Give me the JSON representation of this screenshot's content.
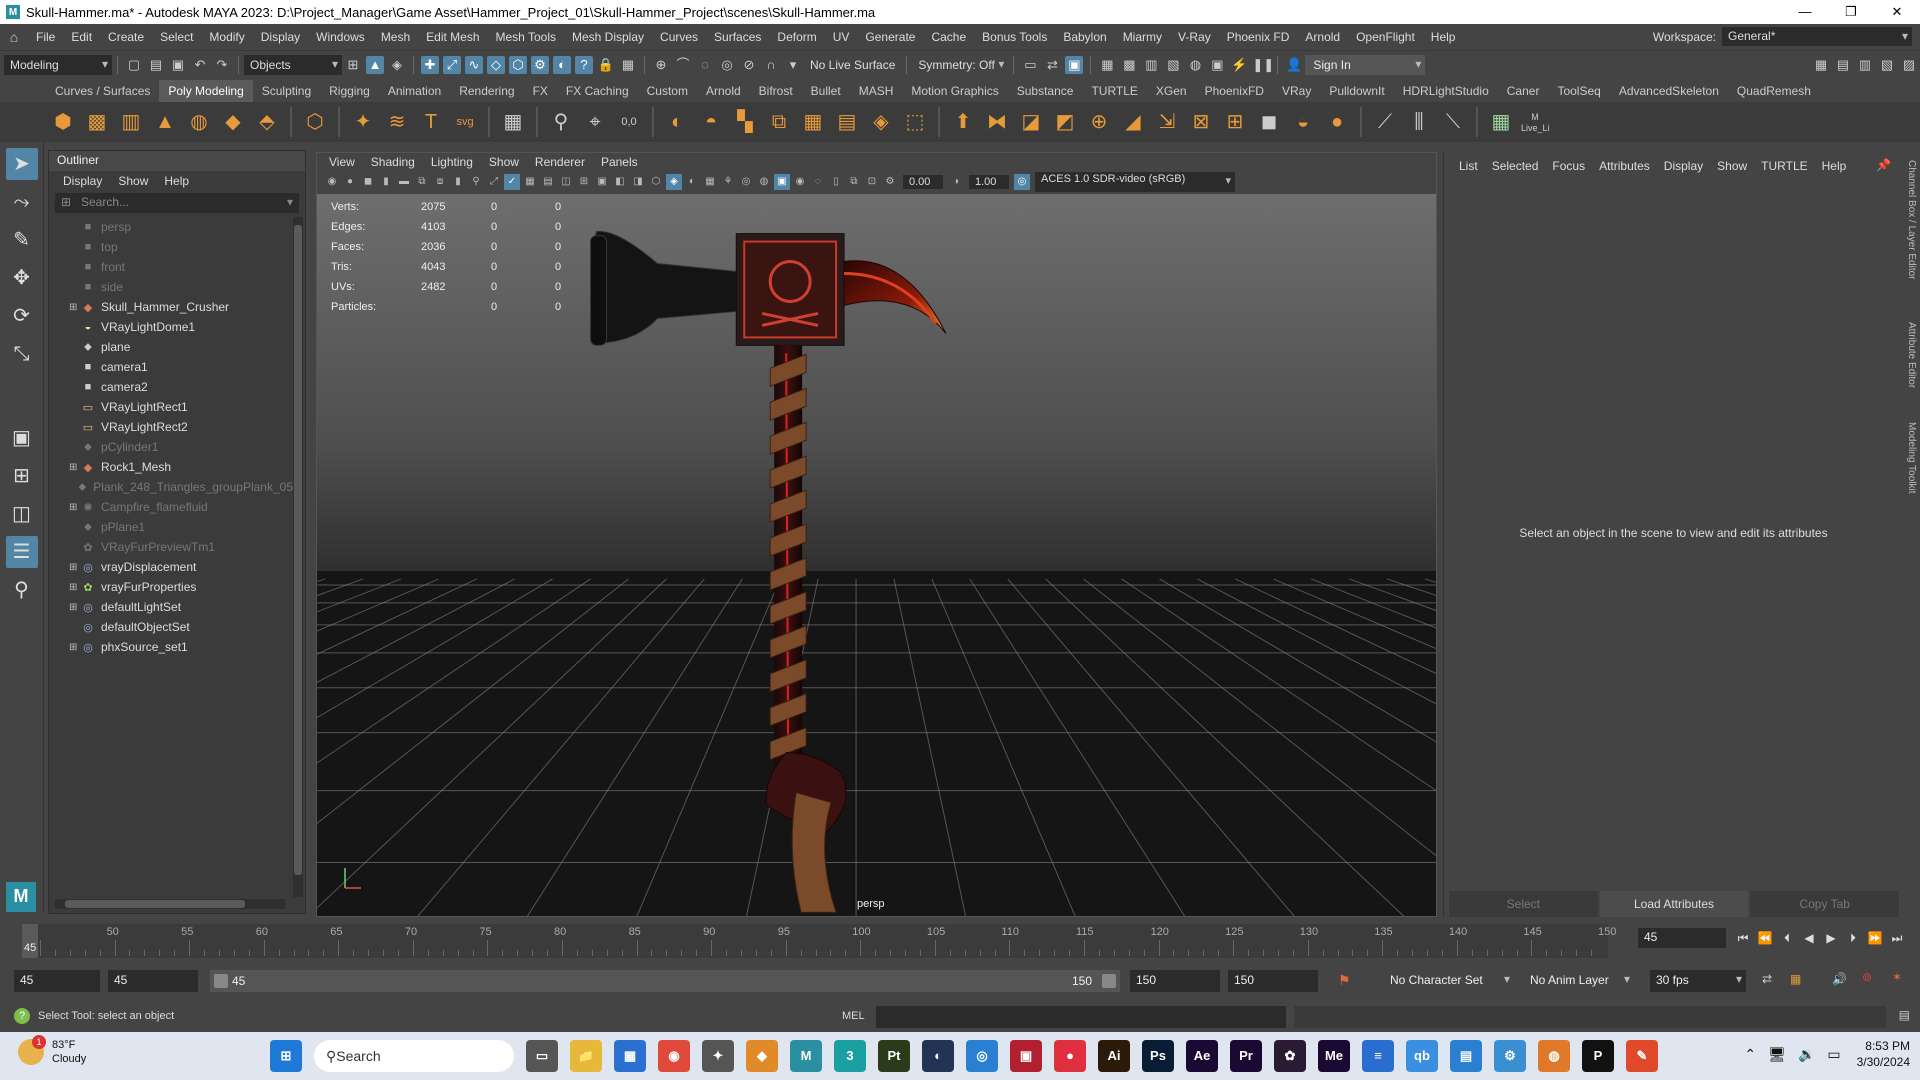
{
  "window": {
    "title": "Skull-Hammer.ma* - Autodesk MAYA 2023: D:\\Project_Manager\\Game Asset\\Hammer_Project_01\\Skull-Hammer_Project\\scenes\\Skull-Hammer.ma",
    "min": "—",
    "max": "❐",
    "close": "✕"
  },
  "menu": {
    "items": [
      "File",
      "Edit",
      "Create",
      "Select",
      "Modify",
      "Display",
      "Windows",
      "Mesh",
      "Edit Mesh",
      "Mesh Tools",
      "Mesh Display",
      "Curves",
      "Surfaces",
      "Deform",
      "UV",
      "Generate",
      "Cache",
      "Bonus Tools",
      "Babylon",
      "Miarmy",
      "V-Ray",
      "Phoenix FD",
      "Arnold",
      "OpenFlight",
      "Help"
    ],
    "workspace_label": "Workspace:",
    "workspace_value": "General*"
  },
  "status": {
    "mode": "Modeling",
    "objects": "Objects",
    "live_surface": "No Live Surface",
    "symmetry": "Symmetry: Off",
    "sign_in": "Sign In"
  },
  "shelf": {
    "tabs": [
      "Curves / Surfaces",
      "Poly Modeling",
      "Sculpting",
      "Rigging",
      "Animation",
      "Rendering",
      "FX",
      "FX Caching",
      "Custom",
      "Arnold",
      "Bifrost",
      "Bullet",
      "MASH",
      "Motion Graphics",
      "Substance",
      "TURTLE",
      "XGen",
      "PhoenixFD",
      "VRay",
      "PulldownIt",
      "HDRLightStudio",
      "Caner",
      "ToolSeq",
      "AdvancedSkeleton",
      "QuadRemesh"
    ],
    "active": "Poly Modeling",
    "live_label": "Live_Li"
  },
  "outliner": {
    "title": "Outliner",
    "menu": [
      "Display",
      "Show",
      "Help"
    ],
    "search_placeholder": "Search...",
    "items": [
      {
        "label": "persp",
        "dim": true,
        "expand": false,
        "icon": "camera-icon"
      },
      {
        "label": "top",
        "dim": true,
        "expand": false,
        "icon": "camera-icon"
      },
      {
        "label": "front",
        "dim": true,
        "expand": false,
        "icon": "camera-icon"
      },
      {
        "label": "side",
        "dim": true,
        "expand": false,
        "icon": "camera-icon"
      },
      {
        "label": "Skull_Hammer_Crusher",
        "dim": false,
        "expand": true,
        "icon": "mesh-icon"
      },
      {
        "label": "VRayLightDome1",
        "dim": false,
        "expand": false,
        "icon": "dome-light-icon"
      },
      {
        "label": "plane",
        "dim": false,
        "expand": false,
        "icon": "transform-icon"
      },
      {
        "label": "camera1",
        "dim": false,
        "expand": false,
        "icon": "camera-icon"
      },
      {
        "label": "camera2",
        "dim": false,
        "expand": false,
        "icon": "camera-icon"
      },
      {
        "label": "VRayLightRect1",
        "dim": false,
        "expand": false,
        "icon": "rect-light-icon"
      },
      {
        "label": "VRayLightRect2",
        "dim": false,
        "expand": false,
        "icon": "rect-light-icon"
      },
      {
        "label": "pCylinder1",
        "dim": true,
        "expand": false,
        "icon": "transform-icon"
      },
      {
        "label": "Rock1_Mesh",
        "dim": false,
        "expand": true,
        "icon": "mesh-icon"
      },
      {
        "label": "Plank_248_Triangles_groupPlank_05",
        "dim": true,
        "expand": false,
        "icon": "transform-icon"
      },
      {
        "label": "Campfire_flamefluid",
        "dim": true,
        "expand": true,
        "icon": "fluid-icon"
      },
      {
        "label": "pPlane1",
        "dim": true,
        "expand": false,
        "icon": "transform-icon"
      },
      {
        "label": "VRayFurPreviewTm1",
        "dim": true,
        "expand": false,
        "icon": "fur-icon"
      },
      {
        "label": "vrayDisplacement",
        "dim": false,
        "expand": true,
        "icon": "set-icon"
      },
      {
        "label": "vrayFurProperties",
        "dim": false,
        "expand": true,
        "icon": "fur-icon"
      },
      {
        "label": "defaultLightSet",
        "dim": false,
        "expand": true,
        "icon": "set-icon"
      },
      {
        "label": "defaultObjectSet",
        "dim": false,
        "expand": false,
        "icon": "set-icon"
      },
      {
        "label": "phxSource_set1",
        "dim": false,
        "expand": true,
        "icon": "set-icon"
      }
    ]
  },
  "viewport": {
    "menu": [
      "View",
      "Shading",
      "Lighting",
      "Show",
      "Renderer",
      "Panels"
    ],
    "exposure": "0.00",
    "gamma": "1.00",
    "color_space": "ACES 1.0 SDR-video (sRGB)",
    "camera": "persp",
    "hud": [
      {
        "label": "Verts:",
        "v": "2075",
        "a": "0",
        "b": "0"
      },
      {
        "label": "Edges:",
        "v": "4103",
        "a": "0",
        "b": "0"
      },
      {
        "label": "Faces:",
        "v": "2036",
        "a": "0",
        "b": "0"
      },
      {
        "label": "Tris:",
        "v": "4043",
        "a": "0",
        "b": "0"
      },
      {
        "label": "UVs:",
        "v": "2482",
        "a": "0",
        "b": "0"
      },
      {
        "label": "Particles:",
        "v": "",
        "a": "0",
        "b": "0"
      }
    ]
  },
  "attribute_editor": {
    "menu": [
      "List",
      "Selected",
      "Focus",
      "Attributes",
      "Display",
      "Show",
      "TURTLE",
      "Help"
    ],
    "message": "Select an object in the scene to view and edit its attributes",
    "buttons": [
      "Select",
      "Load Attributes",
      "Copy Tab"
    ],
    "side_tabs": [
      "Channel Box / Layer Editor",
      "Attribute Editor",
      "Modeling Toolkit"
    ]
  },
  "timeline": {
    "current": "45",
    "ticks": [
      "50",
      "55",
      "60",
      "65",
      "70",
      "75",
      "80",
      "85",
      "90",
      "95",
      "100",
      "105",
      "110",
      "115",
      "120",
      "125",
      "130",
      "135",
      "140",
      "145",
      "150"
    ],
    "frame_field": "45",
    "start": "45",
    "range_start": "45",
    "range_bar_start": "45",
    "range_bar_end": "150",
    "range_end": "150",
    "end": "150",
    "character_set": "No Character Set",
    "anim_layer": "No Anim Layer",
    "fps": "30 fps"
  },
  "command": {
    "hint": "Select Tool: select an object",
    "mel": "MEL"
  },
  "taskbar": {
    "temp": "83°F",
    "condition": "Cloudy",
    "badge": "1",
    "search": "Search",
    "apps": [
      {
        "name": "start-icon",
        "label": "⊞",
        "color": "#1e7ad6"
      },
      {
        "name": "task-view-icon",
        "label": "▭",
        "color": "#555"
      },
      {
        "name": "file-explorer-icon",
        "label": "📁",
        "color": "#e6b93a"
      },
      {
        "name": "store-icon",
        "label": "▦",
        "color": "#2b6fd0"
      },
      {
        "name": "chrome-icon",
        "label": "◉",
        "color": "#e04a3a"
      },
      {
        "name": "app-icon",
        "label": "✦",
        "color": "#555"
      },
      {
        "name": "app2-icon",
        "label": "◆",
        "color": "#e08a2a"
      },
      {
        "name": "maya-icon",
        "label": "M",
        "color": "#2a8fa0"
      },
      {
        "name": "3dsmax-icon",
        "label": "3",
        "color": "#1aa0a0"
      },
      {
        "name": "painter-icon",
        "label": "Pt",
        "color": "#2a3a1a"
      },
      {
        "name": "app3-icon",
        "label": "◐",
        "color": "#223355"
      },
      {
        "name": "app4-icon",
        "label": "◎",
        "color": "#2a7fd0"
      },
      {
        "name": "app5-icon",
        "label": "▣",
        "color": "#b02030"
      },
      {
        "name": "app6-icon",
        "label": "●",
        "color": "#e03040"
      },
      {
        "name": "illustrator-icon",
        "label": "Ai",
        "color": "#2b1a07"
      },
      {
        "name": "photoshop-icon",
        "label": "Ps",
        "color": "#0a1c33"
      },
      {
        "name": "aftereffects-icon",
        "label": "Ae",
        "color": "#1a0a33"
      },
      {
        "name": "premiere-icon",
        "label": "Pr",
        "color": "#1a0a33"
      },
      {
        "name": "app7-icon",
        "label": "✿",
        "color": "#2a1a33"
      },
      {
        "name": "media-encoder-icon",
        "label": "Me",
        "color": "#1a0a33"
      },
      {
        "name": "app8-icon",
        "label": "≡",
        "color": "#2a6fd0"
      },
      {
        "name": "app9-icon",
        "label": "qb",
        "color": "#3a8fe0"
      },
      {
        "name": "app10-icon",
        "label": "▤",
        "color": "#2a7fd0"
      },
      {
        "name": "app11-icon",
        "label": "⚙",
        "color": "#3a8fd0"
      },
      {
        "name": "blender-icon",
        "label": "◍",
        "color": "#e07a2a"
      },
      {
        "name": "app12-icon",
        "label": "P",
        "color": "#111"
      },
      {
        "name": "app13-icon",
        "label": "✎",
        "color": "#e04a2a"
      }
    ],
    "time": "8:53 PM",
    "date": "3/30/2024"
  }
}
